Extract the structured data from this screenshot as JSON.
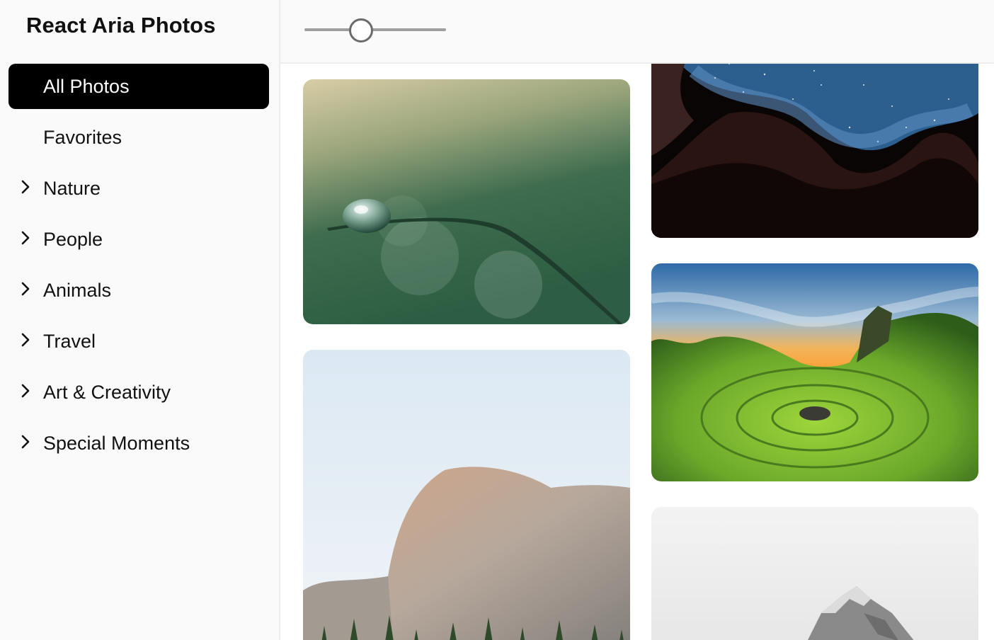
{
  "sidebar": {
    "title": "React Aria Photos",
    "items": [
      {
        "label": "All Photos",
        "selected": true,
        "expandable": false
      },
      {
        "label": "Favorites",
        "selected": false,
        "expandable": false
      },
      {
        "label": "Nature",
        "selected": false,
        "expandable": true
      },
      {
        "label": "People",
        "selected": false,
        "expandable": true
      },
      {
        "label": "Animals",
        "selected": false,
        "expandable": true
      },
      {
        "label": "Travel",
        "selected": false,
        "expandable": true
      },
      {
        "label": "Art & Creativity",
        "selected": false,
        "expandable": true
      },
      {
        "label": "Special Moments",
        "selected": false,
        "expandable": true
      }
    ]
  },
  "toolbar": {
    "zoom_slider": {
      "value_fraction": 0.4
    }
  },
  "photos": [
    {
      "subject": "water droplet on grass blade"
    },
    {
      "subject": "slot canyon with starry night sky"
    },
    {
      "subject": "green valley with stone spiral at sunset"
    },
    {
      "subject": "granite mountain dome with pine trees"
    },
    {
      "subject": "snowy mountain peak in fog"
    }
  ],
  "colors": {
    "selected_bg": "#000000",
    "selected_text": "#ffffff",
    "sidebar_bg": "#fafafa",
    "border": "#ececec"
  }
}
